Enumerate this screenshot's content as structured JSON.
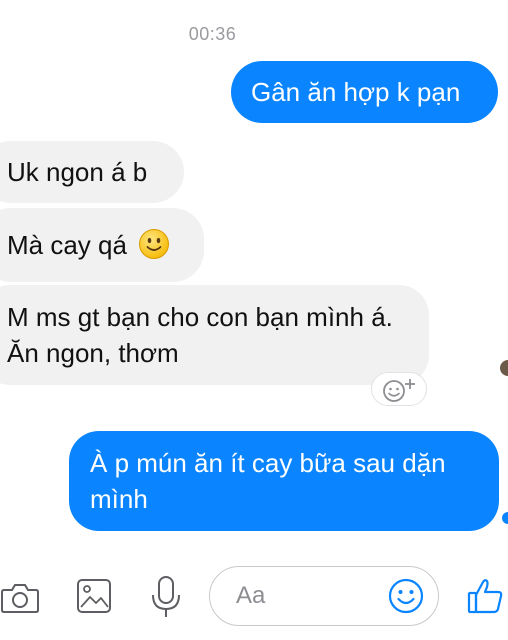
{
  "chat": {
    "timestamp": "00:36",
    "messages": [
      {
        "direction": "out",
        "text": "Gân ăn hợp k pạn"
      },
      {
        "direction": "in",
        "text": "Uk ngon á b"
      },
      {
        "direction": "in",
        "text": "Mà cay qá",
        "emoji": "slightly-smiling-face-icon"
      },
      {
        "direction": "in",
        "text": "M ms gt bạn cho con bạn mình á. Ăn ngon, thơm"
      },
      {
        "direction": "out",
        "text": "À p mún ăn ít cay bữa sau dặn mình"
      }
    ]
  },
  "composer": {
    "placeholder": "Aa",
    "icons": [
      "camera-icon",
      "photo-gallery-icon",
      "microphone-icon",
      "emoji-icon",
      "thumbs-up-icon"
    ]
  },
  "colors": {
    "outgoing_bubble": "#0a84ff",
    "incoming_bubble": "#f1f1f2",
    "accent": "#0a84ff",
    "timestamp": "#9a9a9f"
  }
}
